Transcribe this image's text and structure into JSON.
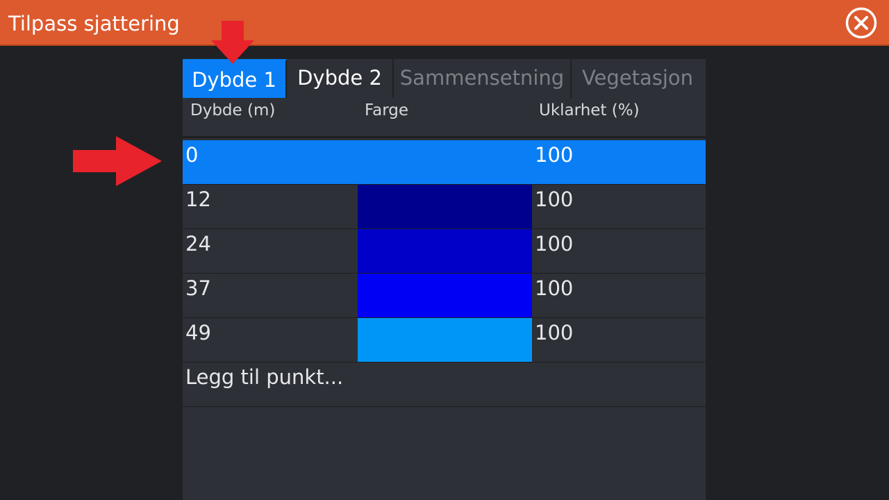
{
  "dialog": {
    "title": "Tilpass sjattering",
    "close_icon": "close-icon"
  },
  "tabs": [
    {
      "label": "Dybde 1",
      "state": "active"
    },
    {
      "label": "Dybde 2",
      "state": "enabled"
    },
    {
      "label": "Sammensetning",
      "state": "disabled"
    },
    {
      "label": "Vegetasjon",
      "state": "disabled"
    }
  ],
  "table": {
    "headers": {
      "depth": "Dybde (m)",
      "color": "Farge",
      "opacity": "Uklarhet (%)"
    },
    "rows": [
      {
        "depth": "0",
        "color": "#0a7ef5",
        "opacity": "100",
        "selected": true
      },
      {
        "depth": "12",
        "color": "#00008f",
        "opacity": "100",
        "selected": false
      },
      {
        "depth": "24",
        "color": "#0000c8",
        "opacity": "100",
        "selected": false
      },
      {
        "depth": "37",
        "color": "#0000f5",
        "opacity": "100",
        "selected": false
      },
      {
        "depth": "49",
        "color": "#0096f8",
        "opacity": "100",
        "selected": false
      }
    ],
    "add_point_label": "Legg til punkt..."
  },
  "colors": {
    "titlebar": "#dc5a2e",
    "accent": "#0a7ef5",
    "panel": "#2d3036",
    "background": "#1f2124",
    "annotation_arrow": "#e8232b"
  },
  "annotations": [
    {
      "icon": "down-arrow-icon",
      "target": "tab-dybde-1"
    },
    {
      "icon": "right-arrow-icon",
      "target": "row-depth-0"
    }
  ]
}
